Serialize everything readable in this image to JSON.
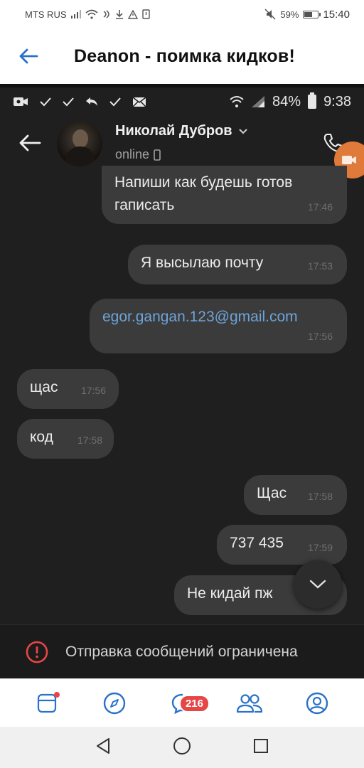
{
  "os_status": {
    "carrier": "MTS RUS",
    "battery": "59%",
    "battery_level": 0.59,
    "time": "15:40"
  },
  "app_header": {
    "title": "Deanon - поимка кидков!"
  },
  "inner_status": {
    "battery": "84%",
    "time": "9:38"
  },
  "chat": {
    "contact_name": "Николай Дубров",
    "contact_status": "online",
    "messages": [
      {
        "text_line1": "Напиши как будешь готов",
        "text_line2": "гаписать",
        "time": "17:46",
        "side": "out"
      },
      {
        "text": "Я высылаю почту",
        "time": "17:53",
        "side": "out"
      },
      {
        "text": "egor.gangan.123@gmail.com",
        "time": "17:56",
        "side": "out",
        "is_link": true
      },
      {
        "text": "щас",
        "time": "17:56",
        "side": "in"
      },
      {
        "text": "код",
        "time": "17:58",
        "side": "in"
      },
      {
        "text": "Щас",
        "time": "17:58",
        "side": "out"
      },
      {
        "text": "737 435",
        "time": "17:59",
        "side": "out"
      },
      {
        "text": "Не кидай пж",
        "time": "",
        "side": "out"
      }
    ],
    "restriction_text": "Отправка сообщений ограничена"
  },
  "tabbar": {
    "messages_badge": "216"
  },
  "icons": {
    "back": "back-arrow-icon",
    "phone": "phone-icon",
    "chevron": "chevron-down-icon",
    "scroll_down": "chevron-down-icon",
    "warning": "warning-circle-icon"
  },
  "colors": {
    "accent_blue": "#2a72c8",
    "link": "#6ea3d8",
    "badge": "#e64646",
    "bubble": "#3b3b3b",
    "chat_bg": "#1f1f1f"
  }
}
